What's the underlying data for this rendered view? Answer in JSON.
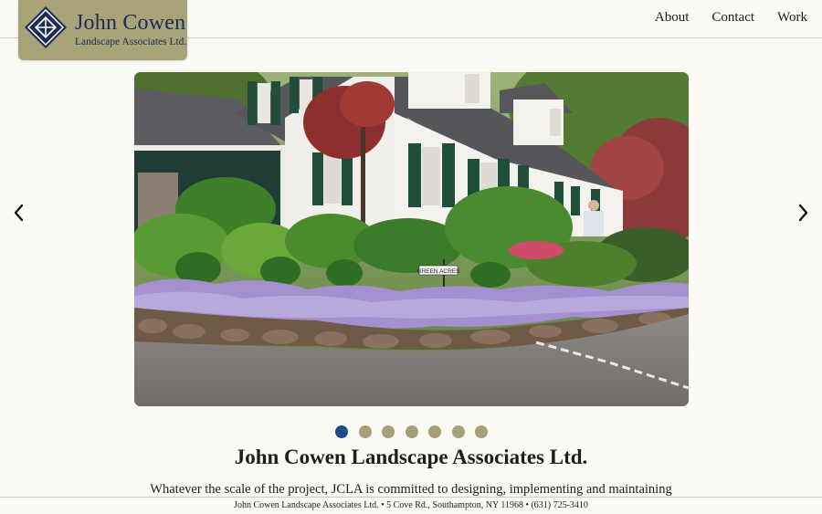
{
  "logo": {
    "name": "John Cowen",
    "subtitle": "Landscape Associates Ltd."
  },
  "nav": {
    "items": [
      {
        "label": "About"
      },
      {
        "label": "Contact"
      },
      {
        "label": "Work"
      }
    ]
  },
  "slider": {
    "slide_count": 7,
    "active_index": 0,
    "sign_text": "GREEN ACRES",
    "prev_icon": "chevron-left-icon",
    "next_icon": "chevron-right-icon"
  },
  "main": {
    "title": "John Cowen Landscape Associates Ltd.",
    "intro": "Whatever the scale of the project, JCLA is committed to designing, implementing and maintaining"
  },
  "footer": {
    "text": "John Cowen Landscape Associates Ltd. • 5 Cove Rd., Southampton, NY 11968 • (631) 725-3410"
  },
  "colors": {
    "background": "#fbfaf4",
    "logo_bg": "#a8a378",
    "logo_text": "#1f2a55",
    "dot_active": "#1f4a8a",
    "dot_inactive": "#a5a07a"
  }
}
